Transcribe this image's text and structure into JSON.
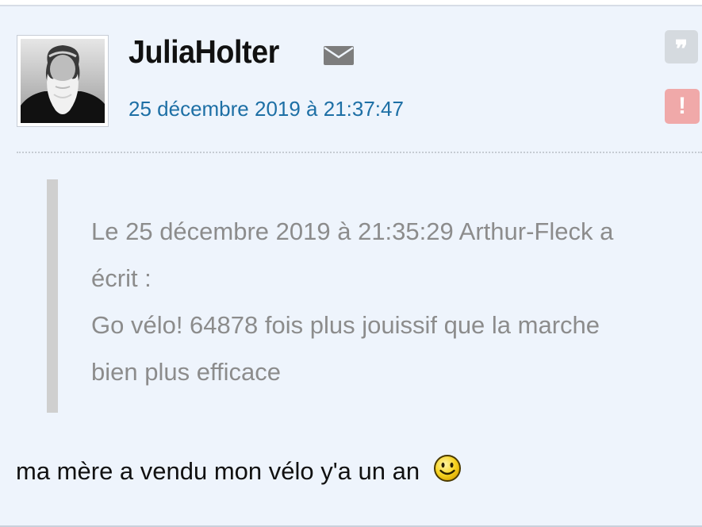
{
  "post": {
    "author": "JuliaHolter",
    "date": "25 décembre 2019 à 21:37:47",
    "icons": {
      "mail": "envelope-icon",
      "quote": "quote-icon",
      "report": "exclamation-icon",
      "smiley": "smiley-icon"
    },
    "quote_button_label": "❞",
    "report_button_label": "!",
    "quote": {
      "header_line1": "Le 25 décembre 2019 à 21:35:29 Arthur-Fleck a",
      "header_line2": "écrit :",
      "body_line1": "Go vélo! 64878 fois plus jouissif que la marche",
      "body_line2": "bien plus efficace"
    },
    "message": "ma mère a vendu mon vélo y'a un an"
  },
  "colors": {
    "post_background": "#eef4fc",
    "date": "#1d6fa5",
    "quote_text": "#8c8c8c",
    "quote_bar": "#cfcfcf",
    "quote_button": "#d5dadf",
    "report_button": "#f0a9a9"
  }
}
